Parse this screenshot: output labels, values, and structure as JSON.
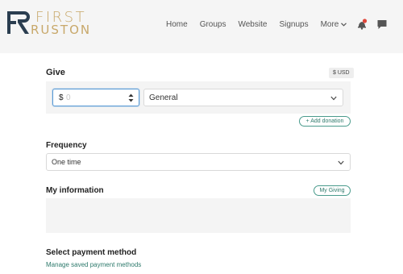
{
  "header": {
    "logo": {
      "line1": "FIRST",
      "line2": "RUSTON",
      "monogram": "FR"
    },
    "nav": {
      "home": "Home",
      "groups": "Groups",
      "website": "Website",
      "signups": "Signups",
      "more": "More"
    },
    "icons": {
      "notifications": "bell-icon",
      "messages": "chat-icon",
      "more_dropdown": "chevron-down-icon"
    }
  },
  "give": {
    "title": "Give",
    "currency_badge": "$ USD",
    "amount": {
      "currency_symbol": "$",
      "placeholder": "0",
      "value": ""
    },
    "fund": {
      "selected": "General"
    },
    "add_donation": "+ Add donation"
  },
  "frequency": {
    "title": "Frequency",
    "selected": "One time"
  },
  "my_information": {
    "title": "My information",
    "my_giving_button": "My Giving"
  },
  "payment": {
    "title": "Select payment method",
    "manage_link": "Manage saved payment methods"
  },
  "colors": {
    "accent": "#2e7a6c",
    "logo_gold": "#c8a86a",
    "logo_navy": "#2b3e50",
    "input_focus": "#5b9bd5",
    "notification_red": "#e0463a"
  }
}
